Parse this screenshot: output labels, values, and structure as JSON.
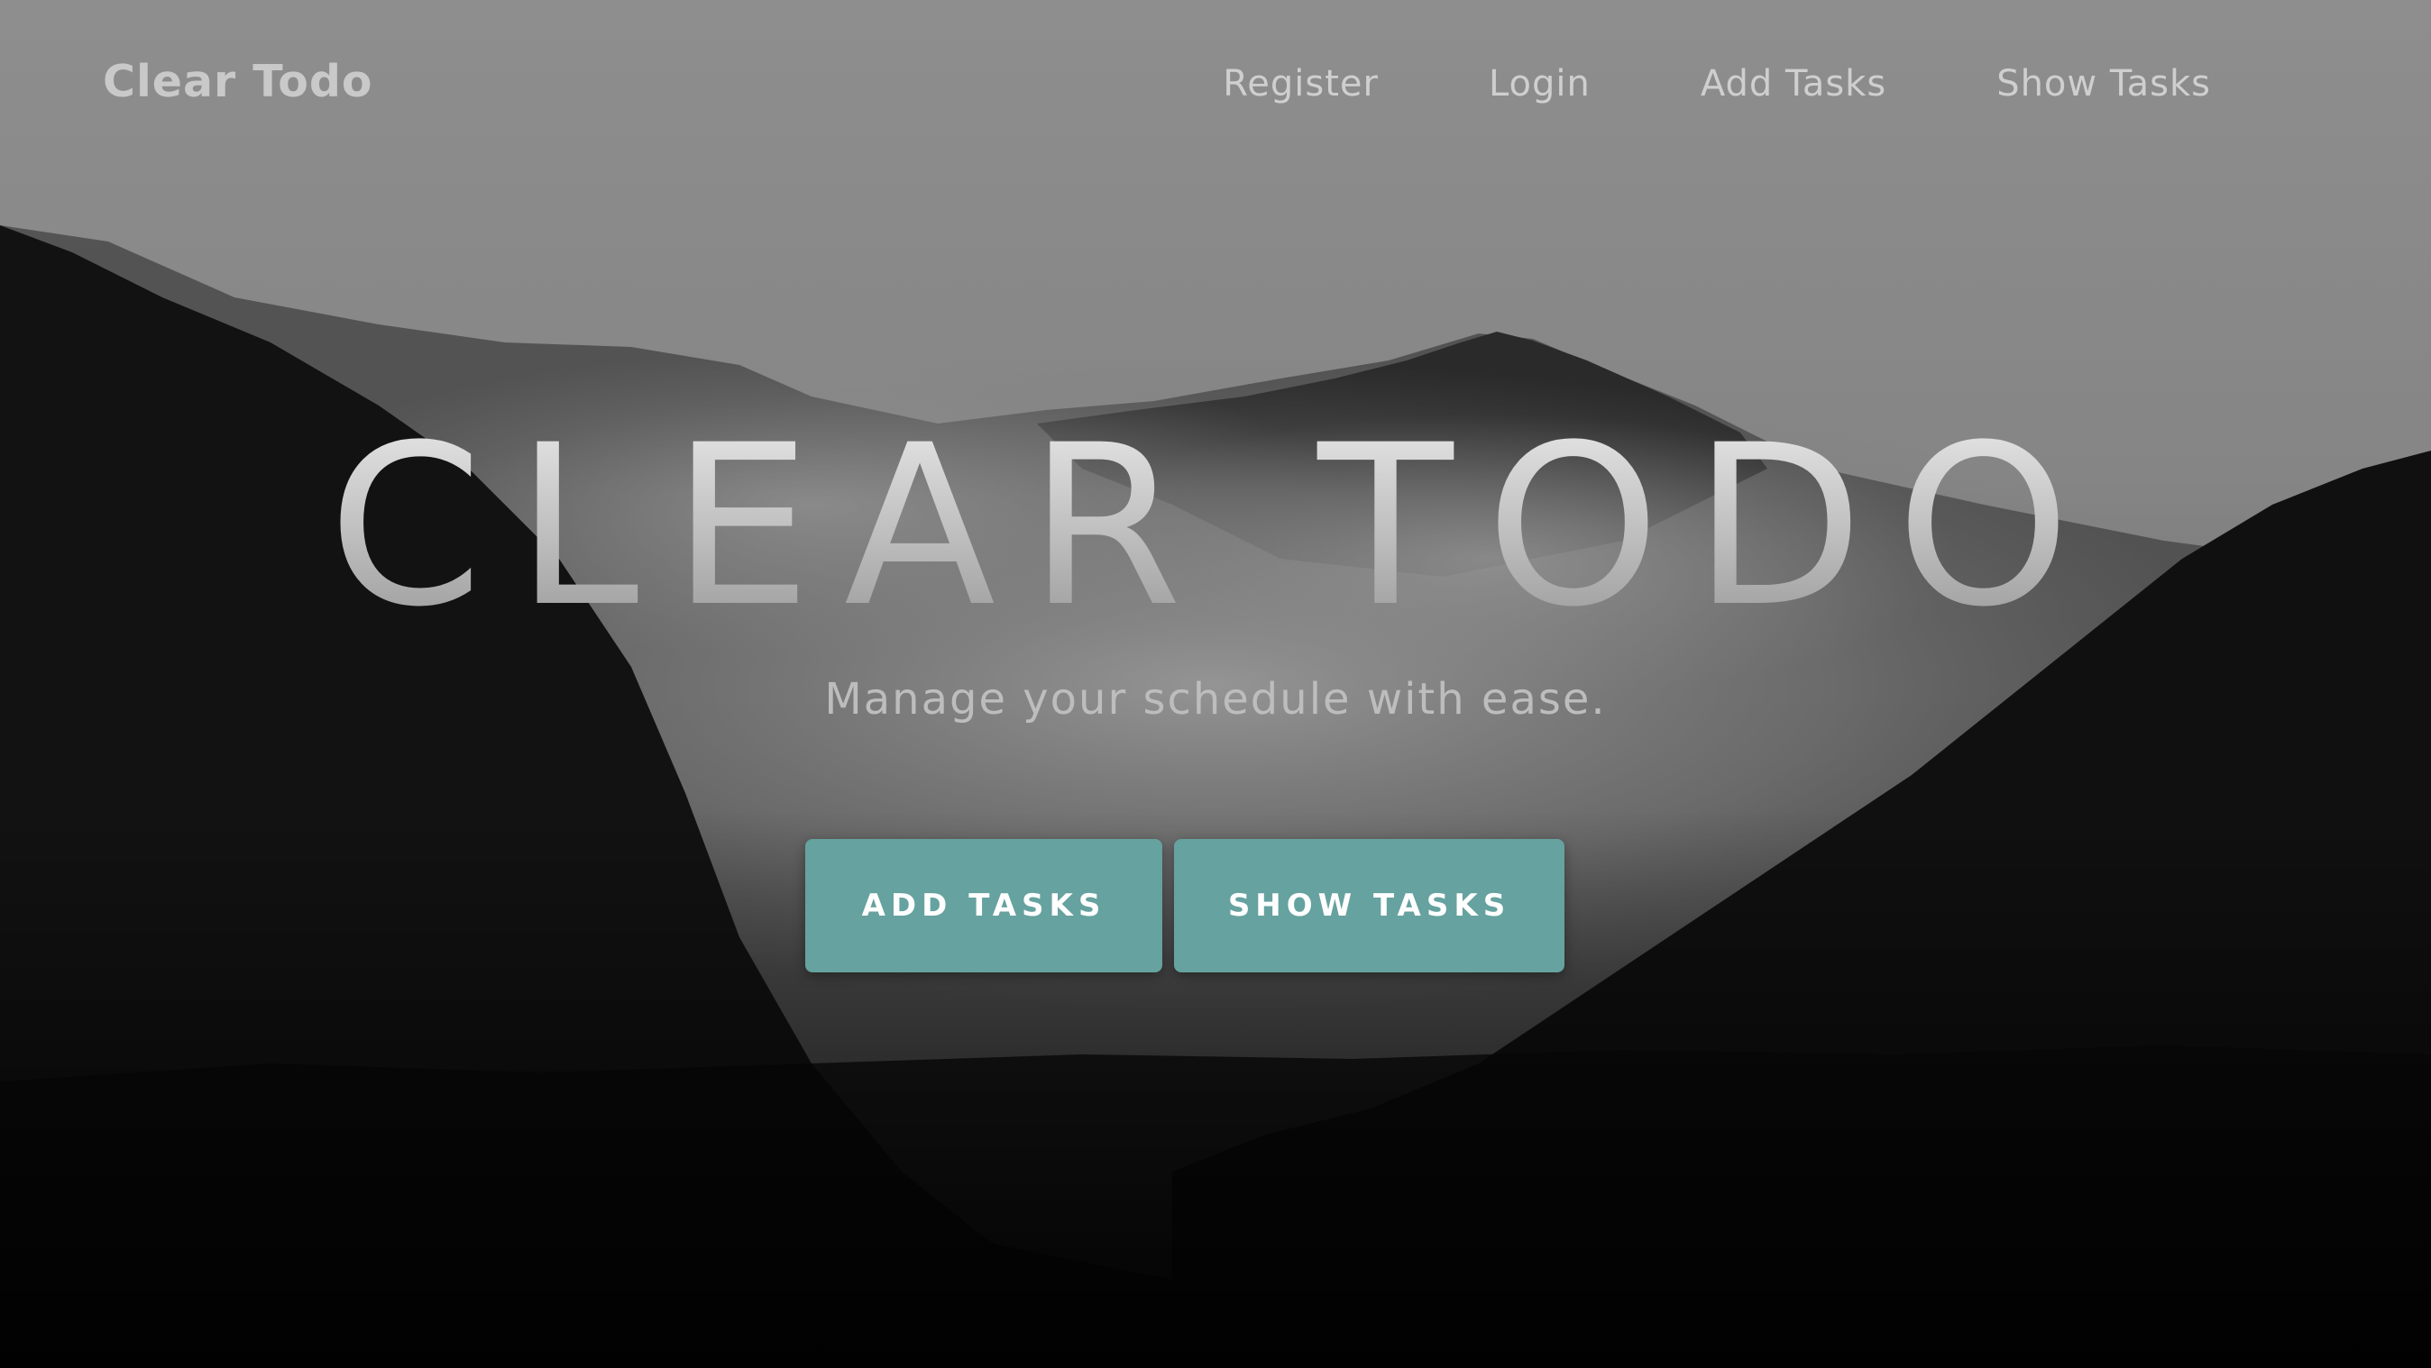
{
  "header": {
    "brand": "Clear Todo",
    "nav": [
      {
        "label": "Register"
      },
      {
        "label": "Login"
      },
      {
        "label": "Add Tasks"
      },
      {
        "label": "Show Tasks"
      }
    ]
  },
  "hero": {
    "title": "CLEAR TODO",
    "subtitle": "Manage your schedule with ease.",
    "buttons": {
      "add_label": "ADD TASKS",
      "show_label": "SHOW TASKS"
    }
  },
  "colors": {
    "accent": "#66a29f",
    "sky": "#8c8c8c",
    "forest": "#0c0c0c"
  }
}
